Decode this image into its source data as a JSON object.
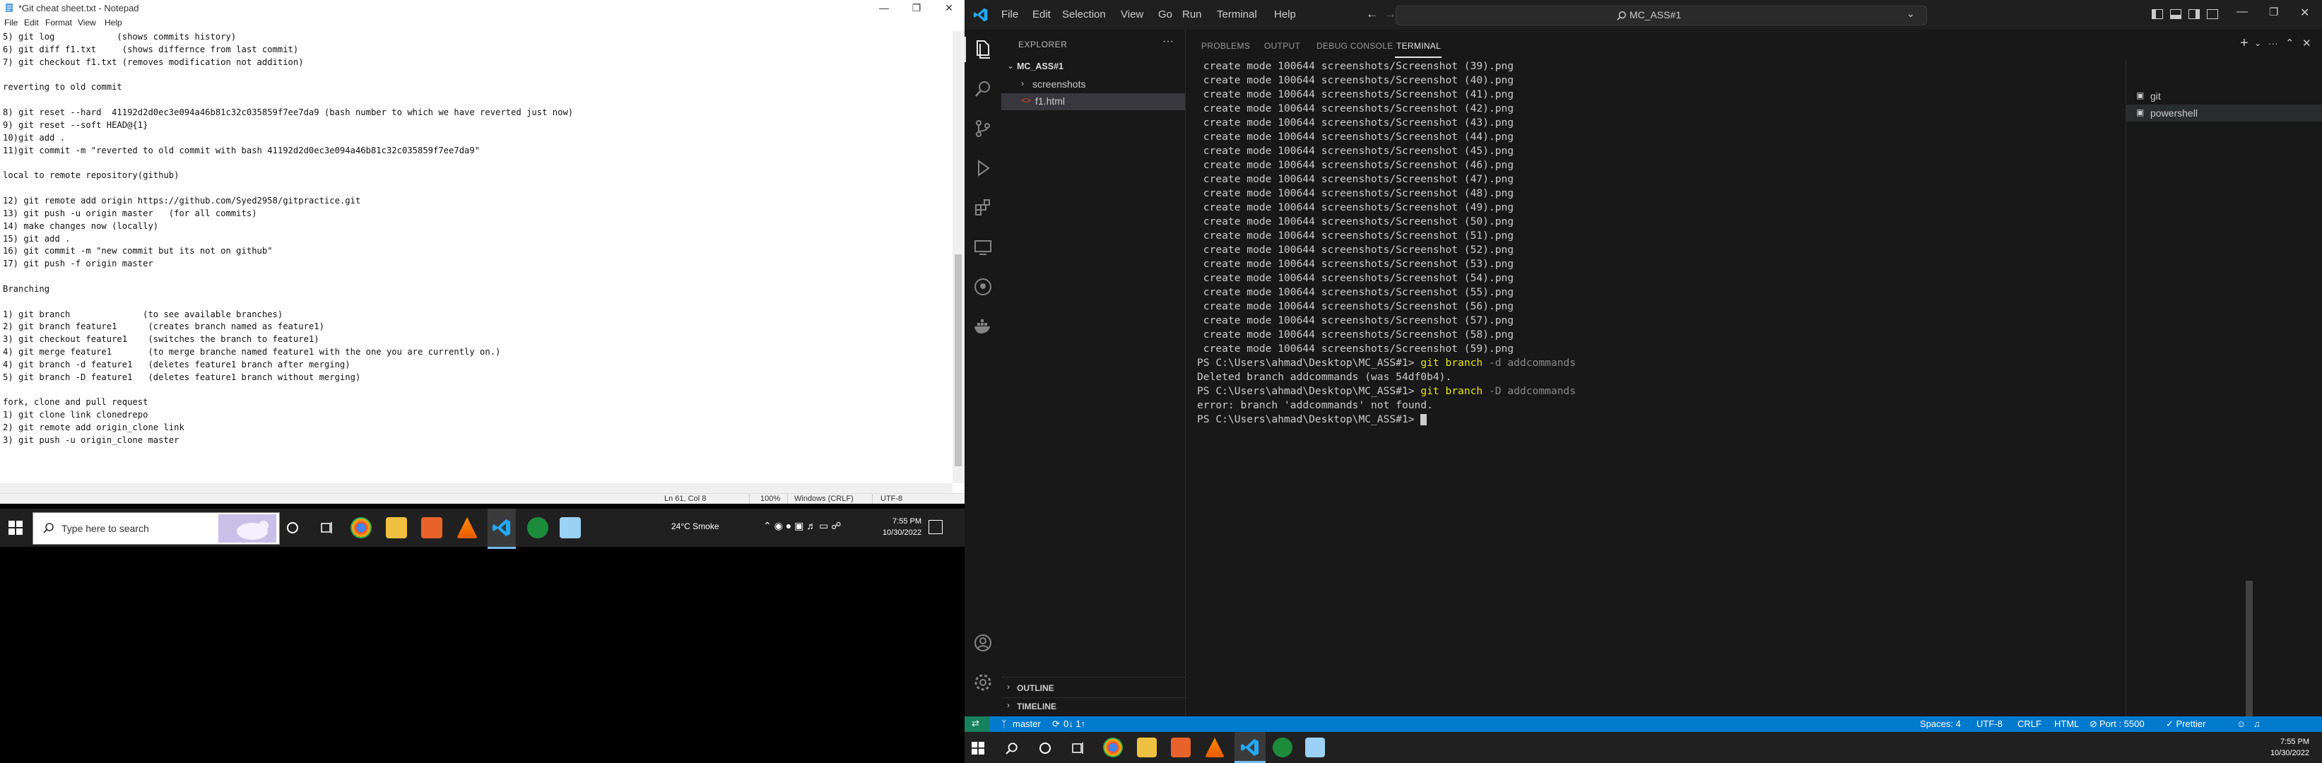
{
  "notepad": {
    "title": "*Git cheat sheet.txt - Notepad",
    "menu": [
      "File",
      "Edit",
      "Format",
      "View",
      "Help"
    ],
    "lines": [
      "5) git log            (shows commits history)",
      "6) git diff f1.txt     (shows differnce from last commit)",
      "7) git checkout f1.txt (removes modification not addition)",
      "",
      "reverting to old commit",
      "",
      "8) git reset --hard  41192d2d0ec3e094a46b81c32c035859f7ee7da9 (bash number to which we have reverted just now)",
      "9) git reset --soft HEAD@{1}",
      "10)git add .",
      "11)git commit -m \"reverted to old commit with bash 41192d2d0ec3e094a46b81c32c035859f7ee7da9\"",
      "",
      "local to remote repository(github)",
      "",
      "12) git remote add origin https://github.com/Syed2958/gitpractice.git",
      "13) git push -u origin master   (for all commits)",
      "14) make changes now (locally)",
      "15) git add .",
      "16) git commit -m \"new commit but its not on github\"",
      "17) git push -f origin master",
      "",
      "Branching",
      "",
      "1) git branch              (to see available branches)",
      "2) git branch feature1      (creates branch named as feature1)",
      "3) git checkout feature1    (switches the branch to feature1)",
      "4) git merge feature1       (to merge branche named feature1 with the one you are currently on.)",
      "4) git branch -d feature1   (deletes feature1 branch after merging)",
      "5) git branch -D feature1   (deletes feature1 branch without merging)",
      "",
      "fork, clone and pull request",
      "1) git clone link clonedrepo",
      "2) git remote add origin_clone link",
      "3) git push -u origin_clone master"
    ],
    "status": {
      "position": "Ln 61, Col 8",
      "zoom": "100%",
      "line_ending": "Windows (CRLF)",
      "encoding": "UTF-8"
    }
  },
  "taskbar_left": {
    "search_placeholder": "Type here to search",
    "weather": "24°C  Smoke",
    "time": "7:55 PM",
    "date": "10/30/2022"
  },
  "vscode": {
    "menu": [
      "File",
      "Edit",
      "Selection",
      "View",
      "Go",
      "Run",
      "Terminal",
      "Help"
    ],
    "search": "MC_ASS#1",
    "explorer": {
      "header": "EXPLORER",
      "root": "MC_ASS#1",
      "items": [
        {
          "label": "screenshots"
        },
        {
          "label": "f1.html"
        }
      ],
      "outline": "OUTLINE",
      "timeline": "TIMELINE"
    },
    "panel_tabs": [
      "PROBLEMS",
      "OUTPUT",
      "DEBUG CONSOLE",
      "TERMINAL"
    ],
    "terminal_lines": [
      " create mode 100644 screenshots/Screenshot (39).png",
      " create mode 100644 screenshots/Screenshot (40).png",
      " create mode 100644 screenshots/Screenshot (41).png",
      " create mode 100644 screenshots/Screenshot (42).png",
      " create mode 100644 screenshots/Screenshot (43).png",
      " create mode 100644 screenshots/Screenshot (44).png",
      " create mode 100644 screenshots/Screenshot (45).png",
      " create mode 100644 screenshots/Screenshot (46).png",
      " create mode 100644 screenshots/Screenshot (47).png",
      " create mode 100644 screenshots/Screenshot (48).png",
      " create mode 100644 screenshots/Screenshot (49).png",
      " create mode 100644 screenshots/Screenshot (50).png",
      " create mode 100644 screenshots/Screenshot (51).png",
      " create mode 100644 screenshots/Screenshot (52).png",
      " create mode 100644 screenshots/Screenshot (53).png",
      " create mode 100644 screenshots/Screenshot (54).png",
      " create mode 100644 screenshots/Screenshot (55).png",
      " create mode 100644 screenshots/Screenshot (56).png",
      " create mode 100644 screenshots/Screenshot (57).png",
      " create mode 100644 screenshots/Screenshot (58).png",
      " create mode 100644 screenshots/Screenshot (59).png"
    ],
    "commands": [
      {
        "prompt": "PS C:\\Users\\ahmad\\Desktop\\MC_ASS#1> ",
        "cmd": "git branch",
        "args": " -d addcommands",
        "output": "Deleted branch addcommands (was 54df0b4)."
      },
      {
        "prompt": "PS C:\\Users\\ahmad\\Desktop\\MC_ASS#1> ",
        "cmd": "git branch",
        "args": " -D addcommands",
        "output": "error: branch 'addcommands' not found."
      }
    ],
    "final_prompt": "PS C:\\Users\\ahmad\\Desktop\\MC_ASS#1> ",
    "terminals": [
      "git",
      "powershell"
    ],
    "status": {
      "branch": "master",
      "sync": "0↓ 1↑",
      "spaces": "Spaces: 4",
      "encoding": "UTF-8",
      "eol": "CRLF",
      "language": "HTML",
      "port": "Port : 5500",
      "prettier": "✓ Prettier"
    }
  },
  "taskbar_right": {
    "time": "7:55 PM",
    "date": "10/30/2022"
  },
  "colors": {
    "vscode_bg": "#1f1f1f",
    "statusbar": "#007acc",
    "terminal_cmd": "#e5e510",
    "taskbar": "#202020"
  }
}
